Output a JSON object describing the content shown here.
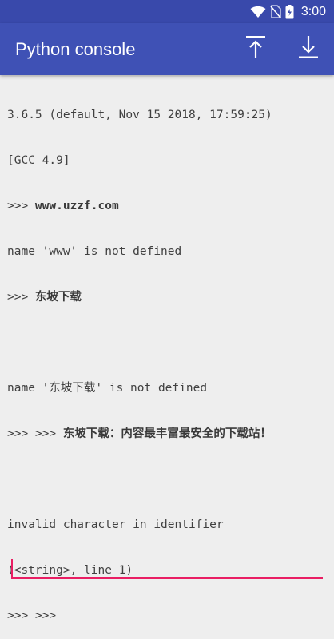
{
  "status_bar": {
    "time": "3:00",
    "icons": [
      "wifi-icon",
      "no-sim-icon",
      "battery-icon"
    ]
  },
  "app_bar": {
    "title": "Python console",
    "actions": [
      {
        "name": "scroll-top-icon"
      },
      {
        "name": "scroll-bottom-icon"
      }
    ]
  },
  "console": {
    "lines": [
      {
        "prompt": "",
        "text": "3.6.5 (default, Nov 15 2018, 17:59:25)"
      },
      {
        "prompt": "",
        "text": "[GCC 4.9]"
      },
      {
        "prompt": ">>> ",
        "text": "www.uzzf.com"
      },
      {
        "prompt": "",
        "text": "name 'www' is not defined"
      },
      {
        "prompt": ">>> ",
        "text": "东坡下载"
      },
      {
        "prompt": "",
        "text": ""
      },
      {
        "prompt": "",
        "text": "name '东坡下载' is not defined"
      },
      {
        "prompt": ">>> >>> ",
        "text": "东坡下载：内容最丰富最安全的下载站！"
      },
      {
        "prompt": "",
        "text": ""
      },
      {
        "prompt": "",
        "text": "invalid character in identifier"
      },
      {
        "prompt": "",
        "text": "(<string>, line 1)"
      },
      {
        "prompt": ">>> >>>",
        "text": ""
      }
    ]
  },
  "input": {
    "value": "",
    "placeholder": ""
  },
  "colors": {
    "status_bar": "#3949AB",
    "app_bar": "#3F51B5",
    "background": "#EEEEEE",
    "accent": "#E91E63"
  }
}
